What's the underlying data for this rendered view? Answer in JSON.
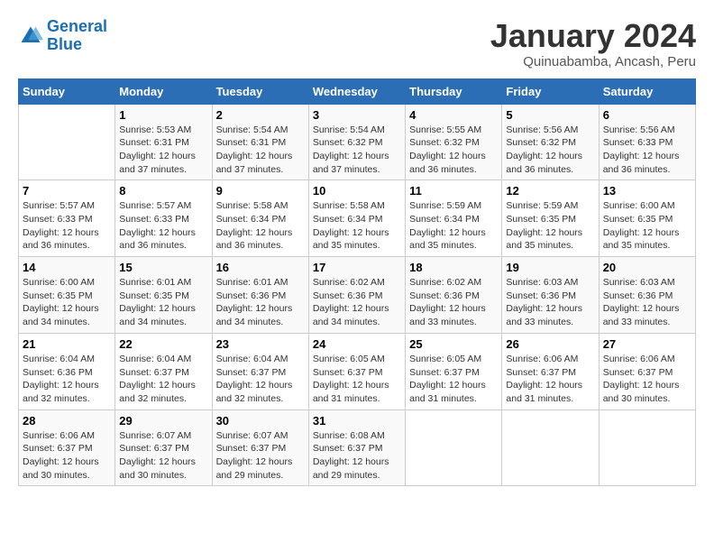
{
  "header": {
    "logo_line1": "General",
    "logo_line2": "Blue",
    "month": "January 2024",
    "location": "Quinuabamba, Ancash, Peru"
  },
  "weekdays": [
    "Sunday",
    "Monday",
    "Tuesday",
    "Wednesday",
    "Thursday",
    "Friday",
    "Saturday"
  ],
  "weeks": [
    [
      {
        "day": "",
        "info": ""
      },
      {
        "day": "1",
        "info": "Sunrise: 5:53 AM\nSunset: 6:31 PM\nDaylight: 12 hours\nand 37 minutes."
      },
      {
        "day": "2",
        "info": "Sunrise: 5:54 AM\nSunset: 6:31 PM\nDaylight: 12 hours\nand 37 minutes."
      },
      {
        "day": "3",
        "info": "Sunrise: 5:54 AM\nSunset: 6:32 PM\nDaylight: 12 hours\nand 37 minutes."
      },
      {
        "day": "4",
        "info": "Sunrise: 5:55 AM\nSunset: 6:32 PM\nDaylight: 12 hours\nand 36 minutes."
      },
      {
        "day": "5",
        "info": "Sunrise: 5:56 AM\nSunset: 6:32 PM\nDaylight: 12 hours\nand 36 minutes."
      },
      {
        "day": "6",
        "info": "Sunrise: 5:56 AM\nSunset: 6:33 PM\nDaylight: 12 hours\nand 36 minutes."
      }
    ],
    [
      {
        "day": "7",
        "info": "Sunrise: 5:57 AM\nSunset: 6:33 PM\nDaylight: 12 hours\nand 36 minutes."
      },
      {
        "day": "8",
        "info": "Sunrise: 5:57 AM\nSunset: 6:33 PM\nDaylight: 12 hours\nand 36 minutes."
      },
      {
        "day": "9",
        "info": "Sunrise: 5:58 AM\nSunset: 6:34 PM\nDaylight: 12 hours\nand 36 minutes."
      },
      {
        "day": "10",
        "info": "Sunrise: 5:58 AM\nSunset: 6:34 PM\nDaylight: 12 hours\nand 35 minutes."
      },
      {
        "day": "11",
        "info": "Sunrise: 5:59 AM\nSunset: 6:34 PM\nDaylight: 12 hours\nand 35 minutes."
      },
      {
        "day": "12",
        "info": "Sunrise: 5:59 AM\nSunset: 6:35 PM\nDaylight: 12 hours\nand 35 minutes."
      },
      {
        "day": "13",
        "info": "Sunrise: 6:00 AM\nSunset: 6:35 PM\nDaylight: 12 hours\nand 35 minutes."
      }
    ],
    [
      {
        "day": "14",
        "info": "Sunrise: 6:00 AM\nSunset: 6:35 PM\nDaylight: 12 hours\nand 34 minutes."
      },
      {
        "day": "15",
        "info": "Sunrise: 6:01 AM\nSunset: 6:35 PM\nDaylight: 12 hours\nand 34 minutes."
      },
      {
        "day": "16",
        "info": "Sunrise: 6:01 AM\nSunset: 6:36 PM\nDaylight: 12 hours\nand 34 minutes."
      },
      {
        "day": "17",
        "info": "Sunrise: 6:02 AM\nSunset: 6:36 PM\nDaylight: 12 hours\nand 34 minutes."
      },
      {
        "day": "18",
        "info": "Sunrise: 6:02 AM\nSunset: 6:36 PM\nDaylight: 12 hours\nand 33 minutes."
      },
      {
        "day": "19",
        "info": "Sunrise: 6:03 AM\nSunset: 6:36 PM\nDaylight: 12 hours\nand 33 minutes."
      },
      {
        "day": "20",
        "info": "Sunrise: 6:03 AM\nSunset: 6:36 PM\nDaylight: 12 hours\nand 33 minutes."
      }
    ],
    [
      {
        "day": "21",
        "info": "Sunrise: 6:04 AM\nSunset: 6:36 PM\nDaylight: 12 hours\nand 32 minutes."
      },
      {
        "day": "22",
        "info": "Sunrise: 6:04 AM\nSunset: 6:37 PM\nDaylight: 12 hours\nand 32 minutes."
      },
      {
        "day": "23",
        "info": "Sunrise: 6:04 AM\nSunset: 6:37 PM\nDaylight: 12 hours\nand 32 minutes."
      },
      {
        "day": "24",
        "info": "Sunrise: 6:05 AM\nSunset: 6:37 PM\nDaylight: 12 hours\nand 31 minutes."
      },
      {
        "day": "25",
        "info": "Sunrise: 6:05 AM\nSunset: 6:37 PM\nDaylight: 12 hours\nand 31 minutes."
      },
      {
        "day": "26",
        "info": "Sunrise: 6:06 AM\nSunset: 6:37 PM\nDaylight: 12 hours\nand 31 minutes."
      },
      {
        "day": "27",
        "info": "Sunrise: 6:06 AM\nSunset: 6:37 PM\nDaylight: 12 hours\nand 30 minutes."
      }
    ],
    [
      {
        "day": "28",
        "info": "Sunrise: 6:06 AM\nSunset: 6:37 PM\nDaylight: 12 hours\nand 30 minutes."
      },
      {
        "day": "29",
        "info": "Sunrise: 6:07 AM\nSunset: 6:37 PM\nDaylight: 12 hours\nand 30 minutes."
      },
      {
        "day": "30",
        "info": "Sunrise: 6:07 AM\nSunset: 6:37 PM\nDaylight: 12 hours\nand 29 minutes."
      },
      {
        "day": "31",
        "info": "Sunrise: 6:08 AM\nSunset: 6:37 PM\nDaylight: 12 hours\nand 29 minutes."
      },
      {
        "day": "",
        "info": ""
      },
      {
        "day": "",
        "info": ""
      },
      {
        "day": "",
        "info": ""
      }
    ]
  ]
}
